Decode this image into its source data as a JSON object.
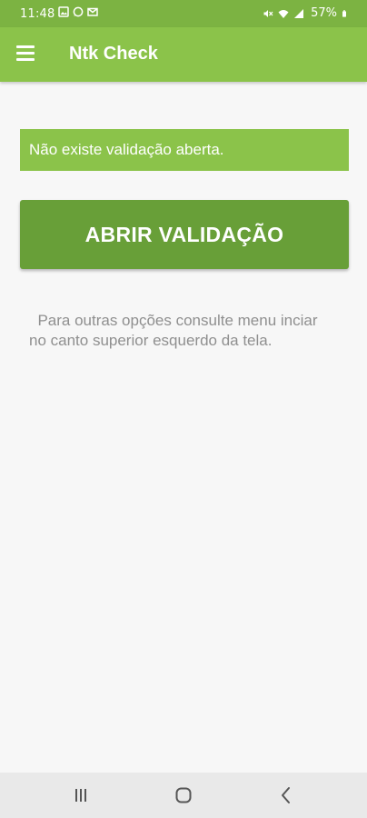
{
  "status_bar": {
    "time": "11:48",
    "battery": "57%",
    "left_icons": [
      "gallery-icon",
      "whatsapp-icon",
      "gmail-icon"
    ],
    "right_icons": [
      "mute-icon",
      "wifi-icon",
      "signal-icon",
      "battery-icon"
    ]
  },
  "app_bar": {
    "title": "Ntk Check",
    "menu_icon": "hamburger-menu-icon",
    "color": "#8bc34a"
  },
  "main": {
    "notice": "Não existe validação aberta.",
    "button_label": "ABRIR VALIDAÇÃO",
    "help_text": "  Para outras opções consulte menu inciar no canto superior esquerdo da tela.",
    "button_color": "#689f38"
  },
  "nav_bar": {
    "buttons": [
      "recent-apps-icon",
      "home-icon",
      "back-icon"
    ]
  }
}
